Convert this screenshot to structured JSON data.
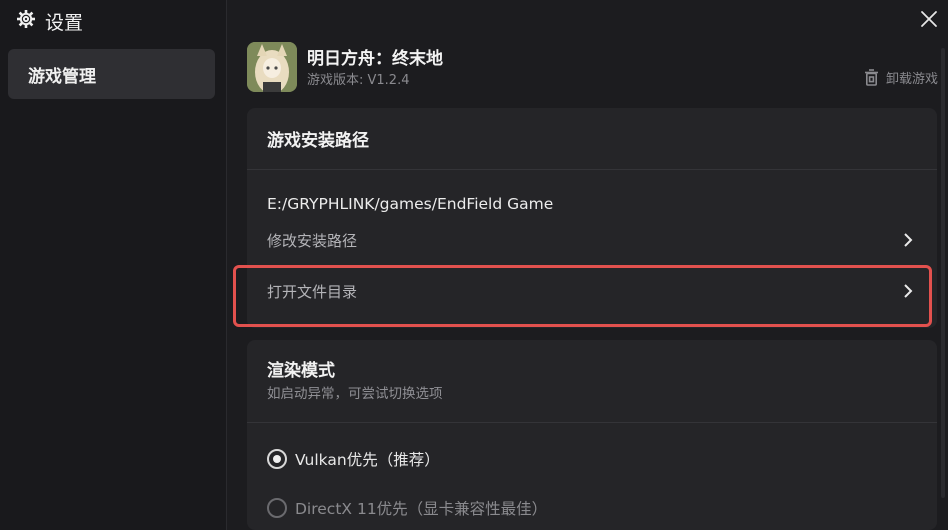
{
  "sidebar": {
    "title": "设置",
    "items": [
      {
        "label": "游戏管理",
        "active": true
      }
    ]
  },
  "game": {
    "name": "明日方舟：终末地",
    "version": "游戏版本: V1.2.4",
    "uninstall_label": "卸载游戏"
  },
  "install_card": {
    "title": "游戏安装路径",
    "path": "E:/GRYPHLINK/games/EndField Game",
    "modify_label": "修改安装路径",
    "open_dir_label": "打开文件目录"
  },
  "render_card": {
    "title": "渲染模式",
    "subtitle": "如启动异常，可尝试切换选项",
    "options": [
      {
        "label": "Vulkan优先（推荐）",
        "selected": true
      },
      {
        "label": "DirectX 11优先（显卡兼容性最佳）",
        "selected": false
      }
    ]
  },
  "colors": {
    "highlight": "#e2514e",
    "card_bg": "#252528",
    "sidebar_active": "#2f2f33"
  },
  "icons": {
    "settings": "gear-icon",
    "close": "close-icon",
    "uninstall": "trash-icon",
    "chevron": "chevron-right-icon"
  }
}
